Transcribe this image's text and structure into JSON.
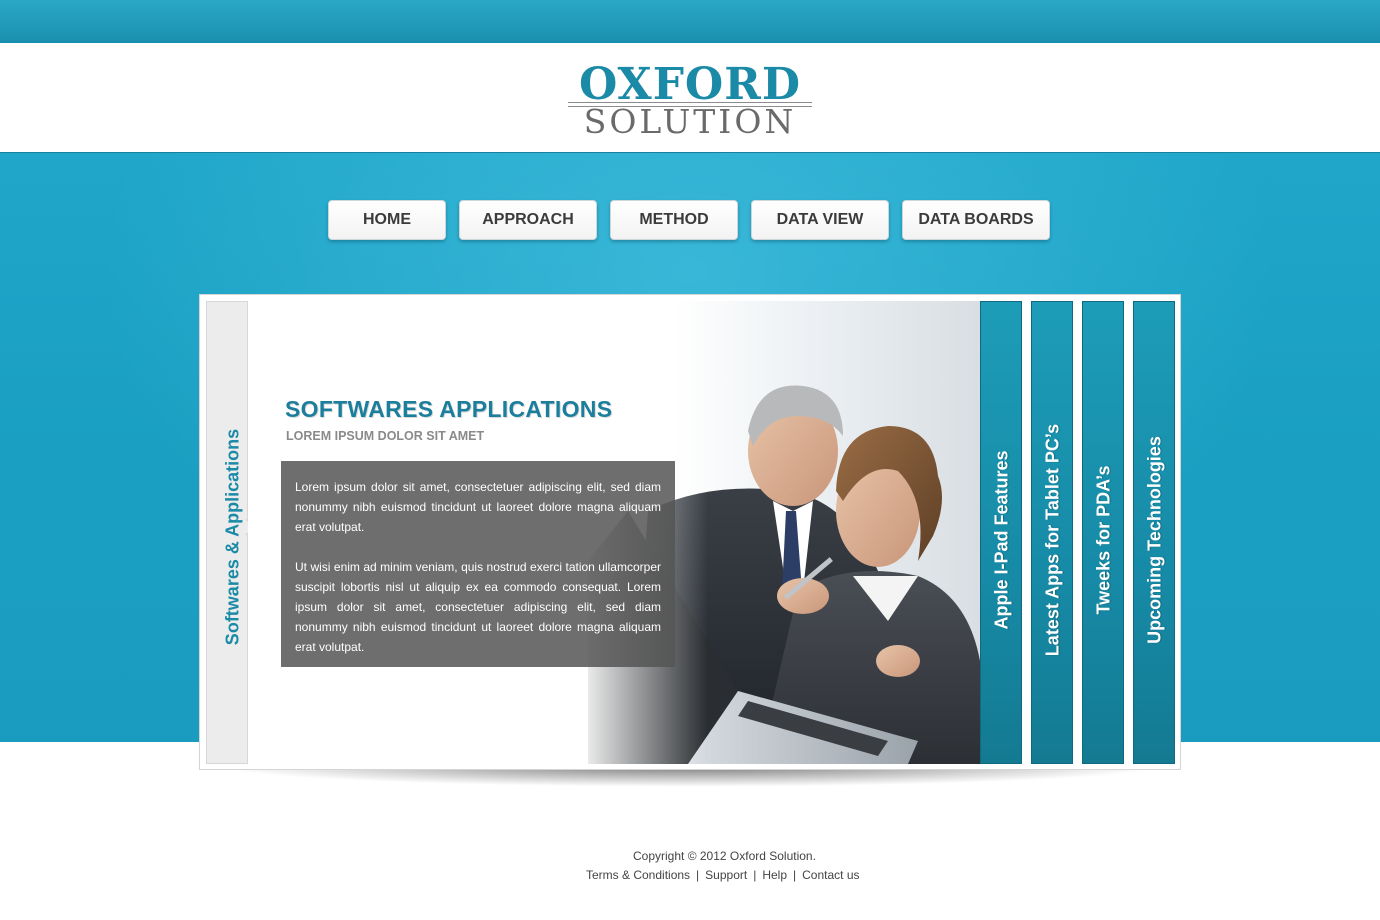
{
  "logo": {
    "top": "OXFORD",
    "bottom": "SOLUTION"
  },
  "nav": {
    "items": [
      {
        "label": "HOME"
      },
      {
        "label": "APPROACH"
      },
      {
        "label": "METHOD"
      },
      {
        "label": "DATA VIEW"
      },
      {
        "label": "DATA BOARDS"
      }
    ]
  },
  "panel": {
    "side_tab": "Softwares & Applications",
    "headline": "SOFTWARES APPLICATIONS",
    "subheadline": "LOREM IPSUM DOLOR SIT AMET",
    "paragraphs": [
      "Lorem ipsum dolor sit amet, consectetuer adipiscing elit, sed diam nonummy nibh euismod tincidunt ut laoreet dolore magna aliquam erat volutpat.",
      "Ut wisi enim ad minim veniam, quis nostrud exerci tation ullamcorper suscipit lobortis nisl ut aliquip ex ea commodo consequat. Lorem ipsum dolor sit amet, consectetuer adipiscing elit, sed diam nonummy nibh euismod tincidunt ut laoreet dolore magna aliquam erat volutpat."
    ],
    "vertical_tabs": [
      {
        "label": "Apple I-Pad Features"
      },
      {
        "label": "Latest Apps for Tablet PC’s"
      },
      {
        "label": "Tweeks for PDA’s"
      },
      {
        "label": "Upcoming Technologies"
      }
    ]
  },
  "footer": {
    "copyright": "Copyright © 2012 Oxford Solution.",
    "links": [
      "Terms & Conditions",
      "Support",
      "Help",
      "Contact us"
    ],
    "separator": "|"
  },
  "colors": {
    "accent": "#1b8aa6",
    "band": "#1fa6c9",
    "tab": "#168aa6"
  }
}
